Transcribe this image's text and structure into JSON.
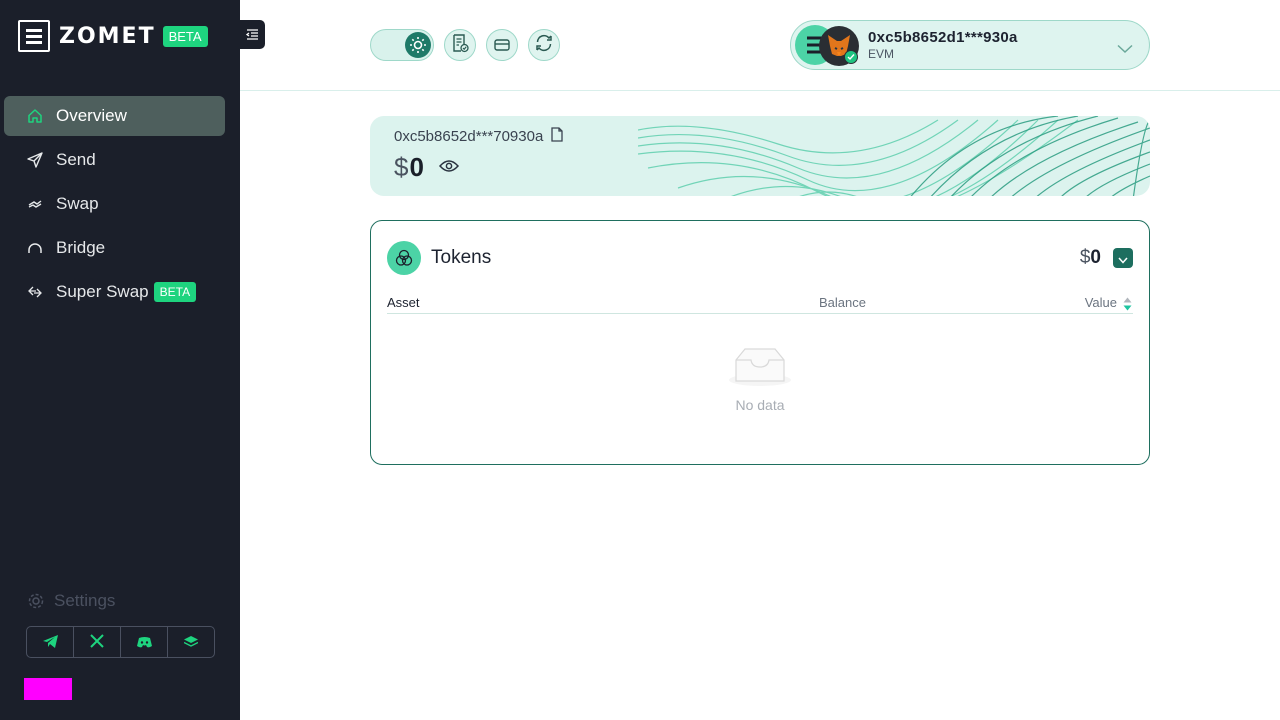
{
  "brand": {
    "name": "ZOMET",
    "badge": "BETA"
  },
  "sidebar": {
    "items": [
      {
        "label": "Overview",
        "icon": "home-icon",
        "active": true
      },
      {
        "label": "Send",
        "icon": "send-icon"
      },
      {
        "label": "Swap",
        "icon": "swap-icon"
      },
      {
        "label": "Bridge",
        "icon": "bridge-icon"
      },
      {
        "label": "Super Swap",
        "icon": "super-swap-icon",
        "badge": "BETA"
      }
    ],
    "settings_label": "Settings",
    "social": [
      "telegram-icon",
      "x-icon",
      "discord-icon",
      "layers-icon"
    ]
  },
  "header": {
    "theme": "light",
    "wallet": {
      "address": "0xc5b8652d1***930a",
      "network": "EVM",
      "provider_icon": "metamask-icon"
    }
  },
  "balance": {
    "address": "0xc5b8652d***70930a",
    "currency": "$",
    "amount": "0"
  },
  "tokens": {
    "title": "Tokens",
    "total_currency": "$",
    "total": "0",
    "columns": {
      "asset": "Asset",
      "balance": "Balance",
      "value": "Value"
    },
    "rows": [],
    "empty_text": "No data"
  },
  "colors": {
    "sidebar_bg": "#1b1f2a",
    "accent": "#1ed47f",
    "teal_dark": "#1f6f5f",
    "card_bg": "#dcf3ee",
    "debug_marker": "#ff00ff"
  }
}
